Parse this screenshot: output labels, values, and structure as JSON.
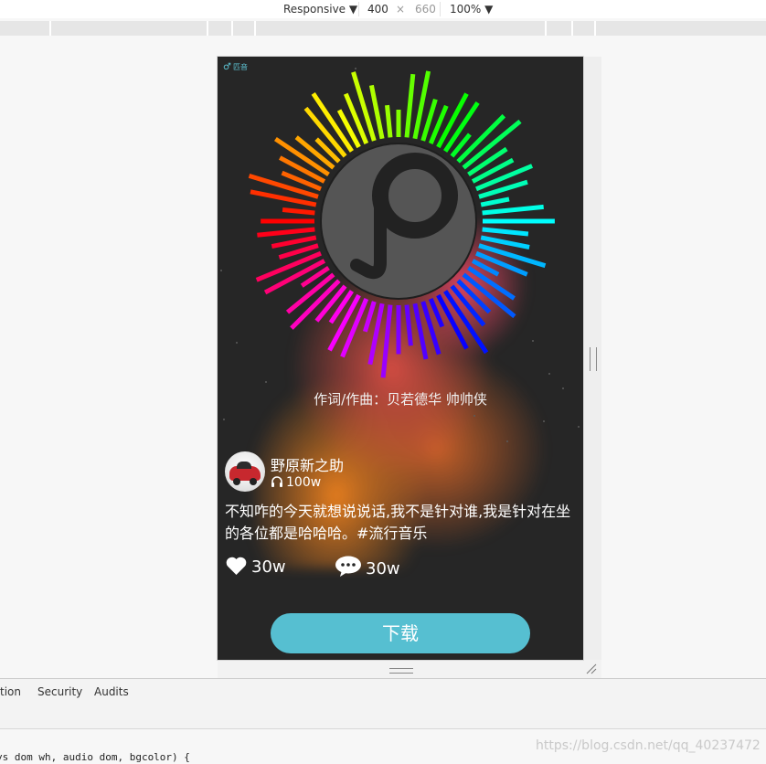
{
  "devtools": {
    "device_mode": "Responsive",
    "viewport_width": "400",
    "viewport_height": "660",
    "times_sign": "×",
    "zoom": "100%",
    "tabs": [
      "tion",
      "Security",
      "Audits"
    ],
    "code_snippet": "ys dom wh, audio dom, bgcolor) {"
  },
  "app": {
    "logo_mark": "♂",
    "logo_text": "匹音",
    "lyrics": "作词/作曲：贝若德华 帅帅侠",
    "user": {
      "name": "野原新之助",
      "listen_count": "100w"
    },
    "description": "不知咋的今天就想说说话,我不是针对谁,我是针对在坐的各位都是哈哈哈。#流行音乐",
    "likes": "30w",
    "comments": "30w",
    "download_label": "下载",
    "colors": {
      "background": "#262626",
      "accent": "#56bfd1",
      "disc": "#555555"
    }
  },
  "watermark": "https://blog.csdn.net/qq_40237472"
}
